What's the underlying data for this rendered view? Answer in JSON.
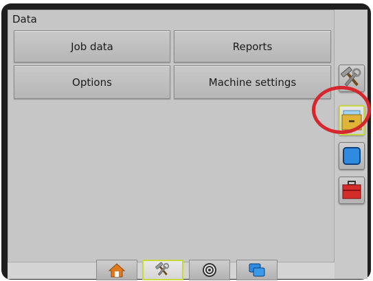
{
  "panel": {
    "title": "Data",
    "buttons": {
      "job_data": "Job data",
      "reports": "Reports",
      "options": "Options",
      "machine_settings": "Machine settings"
    }
  },
  "sidebar": {
    "items": [
      {
        "icon": "tools-icon",
        "selected": false
      },
      {
        "icon": "data-folder-icon",
        "selected": true
      },
      {
        "icon": "blue-square-icon",
        "selected": false
      },
      {
        "icon": "red-toolbox-icon",
        "selected": false
      }
    ]
  },
  "bottom_tabs": [
    {
      "icon": "home-icon",
      "active": false
    },
    {
      "icon": "tools-icon",
      "active": true
    },
    {
      "icon": "gauge-icon",
      "active": false
    },
    {
      "icon": "layers-icon",
      "active": false
    }
  ],
  "colors": {
    "highlight": "#d6262e",
    "selected_border": "#c7d93a"
  }
}
